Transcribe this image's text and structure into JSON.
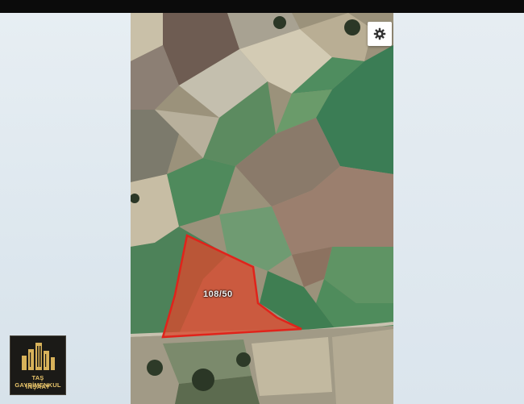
{
  "map": {
    "parcel_label": "108/50",
    "settings_icon": "gear-icon",
    "parcel_outline_color": "#e0231b"
  },
  "logo": {
    "name": "TAŞ GAYRİMENKUL",
    "subtitle": "İNŞAAT"
  }
}
